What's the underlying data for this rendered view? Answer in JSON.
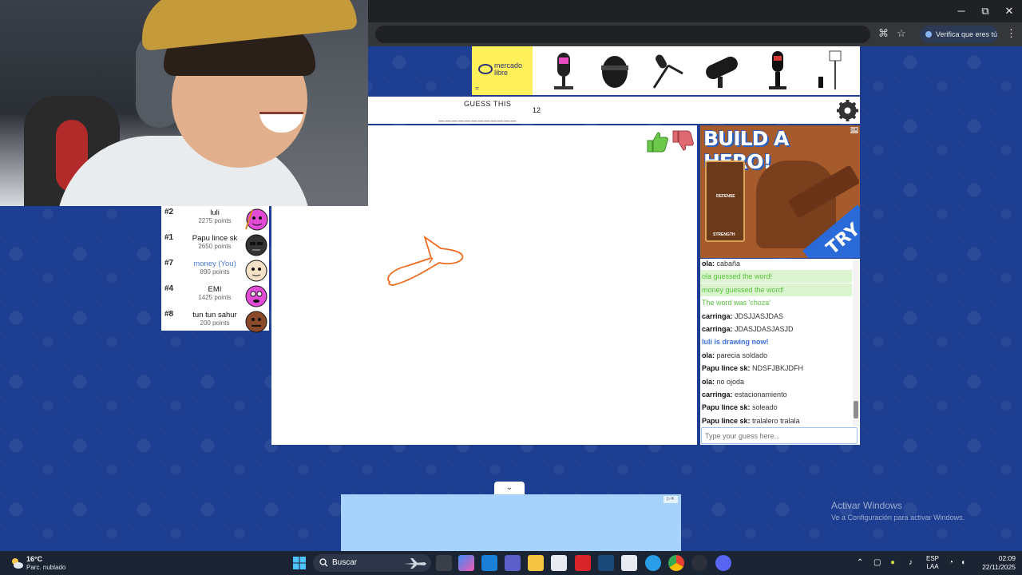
{
  "browser": {
    "verify_pill": "Verifica que eres tú",
    "controls": {
      "minimize": "─",
      "maximize": "⧉",
      "close": "✕"
    }
  },
  "ad_top": {
    "brand": "mercado libre",
    "brand_short": "="
  },
  "game": {
    "guess_label": "GUESS THIS",
    "guess_blanks": "____________",
    "letter_count": "12"
  },
  "players": [
    {
      "rank": "#2",
      "name": "luli",
      "points": "2275 points",
      "avatar_color": "#e24bd6",
      "you": false
    },
    {
      "rank": "#1",
      "name": "Papu lince sk",
      "points": "2650 points",
      "avatar_color": "#333333",
      "you": false
    },
    {
      "rank": "#7",
      "name": "money (You)",
      "points": "890 points",
      "avatar_color": "#f4e1c8",
      "you": true
    },
    {
      "rank": "#4",
      "name": "EMI",
      "points": "1425 points",
      "avatar_color": "#e24bd6",
      "you": false
    },
    {
      "rank": "#8",
      "name": "tun tun sahur",
      "points": "200 points",
      "avatar_color": "#8a4a2a",
      "you": false
    }
  ],
  "side_ad": {
    "title": "BUILD A HERO!",
    "defense": "DEFENSE",
    "strength": "STRENGTH",
    "cta": "TRY",
    "badge": "▷✕"
  },
  "chat": {
    "messages": [
      {
        "user": "ola:",
        "text": "cabaña",
        "style": "normal"
      },
      {
        "user": "",
        "text": "ola guessed the word!",
        "style": "green"
      },
      {
        "user": "",
        "text": "money guessed the word!",
        "style": "green"
      },
      {
        "user": "",
        "text": "The word was 'choza'",
        "style": "greentext"
      },
      {
        "user": "carringa:",
        "text": "JDSJJASJDAS",
        "style": "normal"
      },
      {
        "user": "carringa:",
        "text": "JDASJDASJASJD",
        "style": "normal"
      },
      {
        "user": "",
        "text": "luli is drawing now!",
        "style": "blue"
      },
      {
        "user": "ola:",
        "text": "parecia soldado",
        "style": "normal"
      },
      {
        "user": "Papu lince sk:",
        "text": "NDSFJBKJDFH",
        "style": "normal"
      },
      {
        "user": "ola:",
        "text": "no ojoda",
        "style": "normal"
      },
      {
        "user": "carringa:",
        "text": "estacionamiento",
        "style": "normal"
      },
      {
        "user": "Papu lince sk:",
        "text": "soleado",
        "style": "normal"
      },
      {
        "user": "Papu lince sk:",
        "text": "tralalero tralala",
        "style": "normal"
      }
    ],
    "input_placeholder": "Type your guess here..."
  },
  "bottom_ad": {
    "badge": "▷✕",
    "collapse": "⌄"
  },
  "watermark": {
    "line1": "Activar Windows",
    "line2": "Ve a Configuración para activar Windows."
  },
  "taskbar": {
    "temperature": "16°C",
    "weather": "Parc. nublado",
    "search_label": "Buscar",
    "lang_line1": "ESP",
    "lang_line2": "LAA",
    "time": "02:09",
    "date": "22/11/2025"
  },
  "colors": {
    "background": "#1e3f91",
    "drawing_stroke": "#ef6b1f",
    "ad_yellow": "#fff159",
    "chat_green": "#56c23a",
    "chat_blue": "#3a6fd8",
    "you_blue": "#4a7bd6"
  }
}
